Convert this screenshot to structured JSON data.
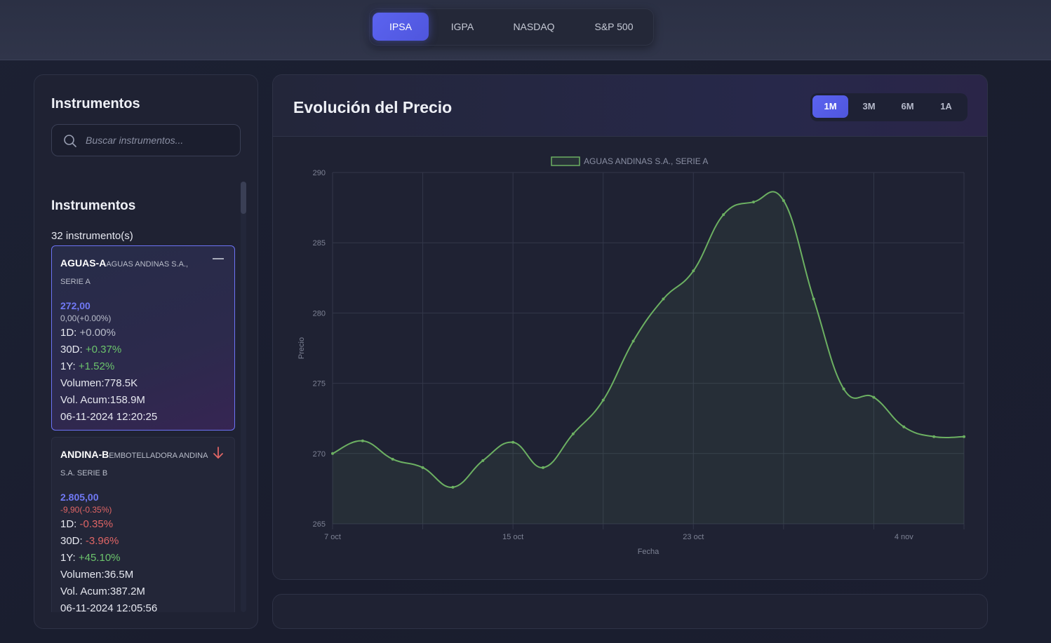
{
  "market_tabs": [
    {
      "label": "IPSA",
      "active": true
    },
    {
      "label": "IGPA",
      "active": false
    },
    {
      "label": "NASDAQ",
      "active": false
    },
    {
      "label": "S&P 500",
      "active": false
    }
  ],
  "sidebar": {
    "title": "Instrumentos",
    "search_placeholder": "Buscar instrumentos...",
    "list_title": "Instrumentos",
    "count_label": "32 instrumento(s)",
    "cards": [
      {
        "ticker": "AGUAS-A",
        "name": "AGUAS ANDINAS S.A., SERIE A",
        "trend_icon": "dash-icon",
        "price": "272,00",
        "change": "0,00(+0.00%)",
        "d1_label": "1D:",
        "d1_value": "+0.00%",
        "d30_label": "30D:",
        "d30_value": "+0.37%",
        "y1_label": "1Y:",
        "y1_value": "+1.52%",
        "volume": "Volumen:778.5K",
        "vol_acum": "Vol. Acum:158.9M",
        "timestamp": "06-11-2024 12:20:25"
      },
      {
        "ticker": "ANDINA-B",
        "name": "EMBOTELLADORA ANDINA S.A. SERIE B",
        "trend_icon": "arrow-down-icon",
        "price": "2.805,00",
        "change": "-9,90(-0.35%)",
        "d1_label": "1D:",
        "d1_value": "-0.35%",
        "d30_label": "30D:",
        "d30_value": "-3.96%",
        "y1_label": "1Y:",
        "y1_value": "+45.10%",
        "volume": "Volumen:36.5M",
        "vol_acum": "Vol. Acum:387.2M",
        "timestamp": "06-11-2024 12:05:56"
      }
    ]
  },
  "chart_panel": {
    "title": "Evolución del Precio",
    "ranges": [
      {
        "label": "1M",
        "active": true
      },
      {
        "label": "3M",
        "active": false
      },
      {
        "label": "6M",
        "active": false
      },
      {
        "label": "1A",
        "active": false
      }
    ]
  },
  "colors": {
    "accent": "#5b63f0",
    "positive": "#6cc46c",
    "negative": "#e06565",
    "line": "#6cb062"
  },
  "chart_data": {
    "type": "line",
    "legend": "AGUAS ANDINAS S.A., SERIE A",
    "xlabel": "Fecha",
    "ylabel": "Precio",
    "ylim": [
      265,
      290
    ],
    "yticks": [
      265,
      270,
      275,
      280,
      285,
      290
    ],
    "xtick_labels": [
      "7 oct",
      "15 oct",
      "23 oct",
      "4 nov"
    ],
    "x": [
      "7 oct",
      "8 oct",
      "9 oct",
      "10 oct",
      "11 oct",
      "14 oct",
      "15 oct",
      "16 oct",
      "17 oct",
      "18 oct",
      "21 oct",
      "22 oct",
      "23 oct",
      "24 oct",
      "25 oct",
      "28 oct",
      "29 oct",
      "30 oct",
      "31 oct",
      "4 nov",
      "5 nov",
      "6 nov"
    ],
    "values": [
      270.0,
      270.9,
      269.6,
      269.0,
      267.6,
      269.5,
      270.8,
      269.0,
      271.4,
      273.8,
      278.0,
      281.0,
      283.0,
      287.0,
      287.9,
      288.0,
      281.0,
      274.6,
      274.0,
      271.9,
      271.2,
      271.2
    ],
    "grid": true,
    "legend_position": "top",
    "fill": true
  }
}
